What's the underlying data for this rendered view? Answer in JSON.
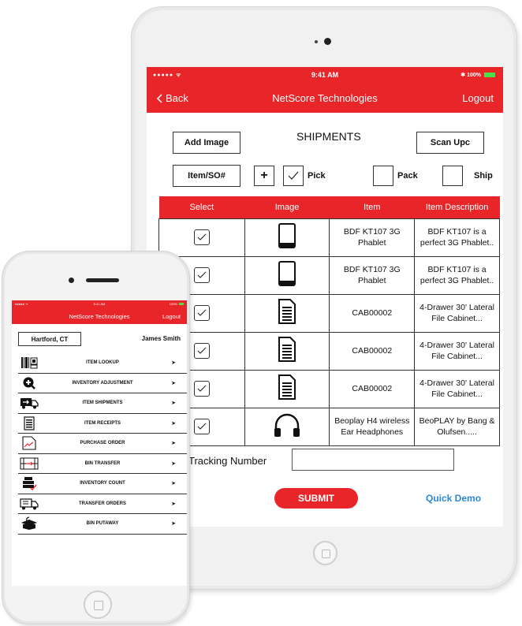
{
  "tablet": {
    "status": {
      "signal": "●●●●● ᯤ",
      "time": "9:41 AM",
      "battery": "✱ 100%"
    },
    "nav": {
      "back_label": "Back",
      "title": "NetScore Technologies",
      "logout_label": "Logout"
    },
    "toolbar": {
      "add_image_label": "Add Image",
      "page_title": "SHIPMENTS",
      "scan_upc_label": "Scan Upc",
      "item_so_label": "Item/SO#",
      "plus_label": "+"
    },
    "options": [
      {
        "label": "Pick",
        "checked": true
      },
      {
        "label": "Pack",
        "checked": false
      },
      {
        "label": "Ship",
        "checked": false
      }
    ],
    "table": {
      "headers": [
        "Select",
        "Image",
        "Item",
        "Item Description"
      ],
      "rows": [
        {
          "icon": "tablet-icon",
          "item": "BDF KT107 3G Phablet",
          "description": "BDF KT107 is a perfect 3G Phablet..",
          "checked": true
        },
        {
          "icon": "tablet-icon",
          "item": "BDF KT107 3G Phablet",
          "description": "BDF KT107 is a perfect 3G Phablet..",
          "checked": true
        },
        {
          "icon": "document-icon",
          "item": "CAB00002",
          "description": "4-Drawer 30' Lateral File Cabinet...",
          "checked": true
        },
        {
          "icon": "document-icon",
          "item": "CAB00002",
          "description": "4-Drawer 30' Lateral File Cabinet...",
          "checked": true
        },
        {
          "icon": "document-icon",
          "item": "CAB00002",
          "description": "4-Drawer 30' Lateral File Cabinet...",
          "checked": true
        },
        {
          "icon": "headphones-icon",
          "item": "Beoplay H4 wireless Ear Headphones",
          "description": "BeoPLAY by Bang & Olufsen.....",
          "checked": true
        }
      ]
    },
    "tracking": {
      "label": "Tracking Number",
      "value": ""
    },
    "submit_label": "SUBMIT",
    "quick_demo_label": "Quick Demo"
  },
  "phone": {
    "status": {
      "signal": "●●●●● ᯤ",
      "time": "9:41 AM",
      "battery": "100%"
    },
    "nav": {
      "title": "NetScore Technologies",
      "logout_label": "Logout"
    },
    "location": "Hartford, CT",
    "user_name": "James Smith",
    "menu": [
      {
        "label": "ITEM LOOKUP",
        "icon": "barcode-icon"
      },
      {
        "label": "INVENTORY ADJUSTMENT",
        "icon": "adjust-icon"
      },
      {
        "label": "ITEM SHIPMENTS",
        "icon": "truck-icon"
      },
      {
        "label": "ITEM RECEIPTS",
        "icon": "receipt-icon"
      },
      {
        "label": "PURCHASE ORDER",
        "icon": "purchase-order-icon"
      },
      {
        "label": "BIN TRANSFER",
        "icon": "bin-transfer-icon"
      },
      {
        "label": "INVENTORY COUNT",
        "icon": "inventory-count-icon"
      },
      {
        "label": "TRANSFER ORDERS",
        "icon": "transfer-orders-icon"
      },
      {
        "label": "BIN PUTAWAY",
        "icon": "bin-putaway-icon"
      }
    ],
    "arrow": "➤"
  },
  "colors": {
    "brand_red": "#e8262a",
    "link_blue": "#2b88d8",
    "battery_green": "#4be04b"
  }
}
